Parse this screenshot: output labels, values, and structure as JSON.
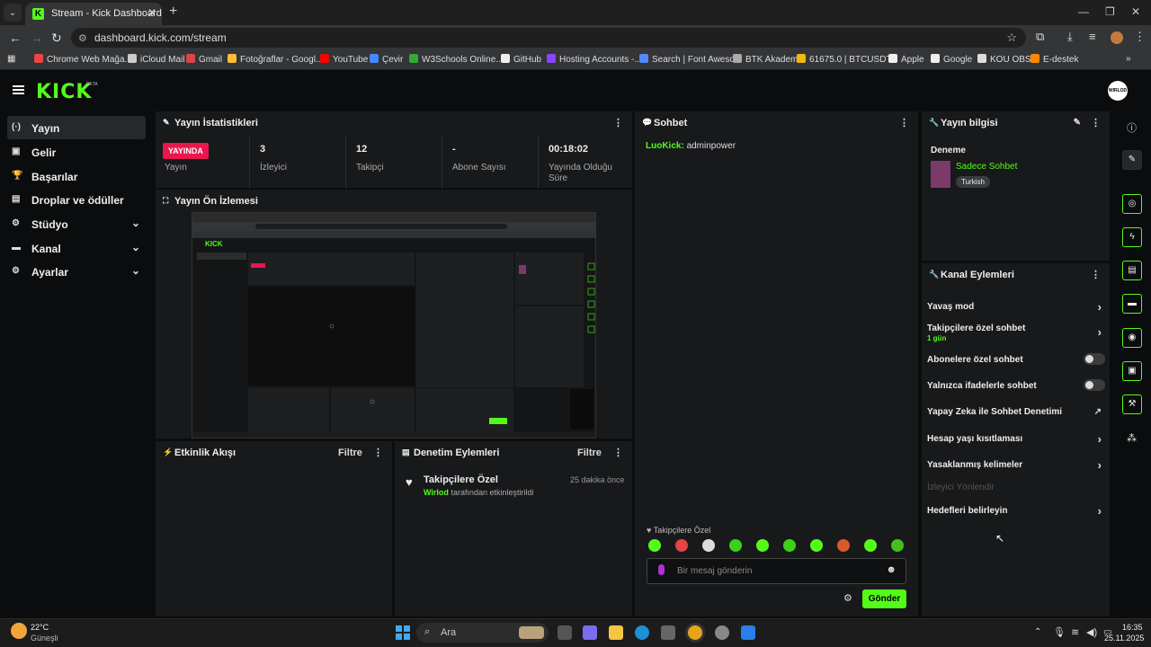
{
  "browser": {
    "tab_title": "Stream - Kick Dashboard",
    "url": "dashboard.kick.com/stream",
    "bookmarks": [
      "Chrome Web Mağa...",
      "iCloud Mail",
      "Gmail",
      "Fotoğraflar - Googl...",
      "YouTube",
      "Çevir",
      "W3Schools Online...",
      "GitHub",
      "Hosting Accounts -...",
      "Search | Font Aweso...",
      "BTK Akademi",
      "61675.0 | BTCUSDT...",
      "Apple",
      "Google",
      "KOU OBS",
      "E-destek"
    ]
  },
  "header": {
    "logo": "KICK",
    "beta": "BETA",
    "avatar_text": "WIRLOD"
  },
  "sidebar": {
    "items": [
      {
        "label": "Yayın",
        "icon": "broadcast-icon"
      },
      {
        "label": "Gelir",
        "icon": "revenue-icon"
      },
      {
        "label": "Başarılar",
        "icon": "trophy-icon"
      },
      {
        "label": "Droplar ve ödüller",
        "icon": "gift-icon"
      },
      {
        "label": "Stüdyo",
        "icon": "gear-icon"
      },
      {
        "label": "Kanal",
        "icon": "channel-icon"
      },
      {
        "label": "Ayarlar",
        "icon": "settings-icon"
      }
    ]
  },
  "stats": {
    "title": "Yayın İstatistikleri",
    "live_badge": "YAYINDA",
    "items": [
      {
        "value": "",
        "label": "Yayın"
      },
      {
        "value": "3",
        "label": "İzleyici"
      },
      {
        "value": "12",
        "label": "Takipçi"
      },
      {
        "value": "-",
        "label": "Abone Sayısı"
      },
      {
        "value": "00:18:02",
        "label": "Yayında Olduğu Süre"
      }
    ]
  },
  "preview": {
    "title": "Yayın Ön İzlemesi"
  },
  "activity": {
    "title": "Etkinlik Akışı",
    "filter": "Filtre"
  },
  "moderation": {
    "title": "Denetim Eylemleri",
    "filter": "Filtre",
    "event_title": "Takipçilere Özel",
    "event_time": "25 dakika önce",
    "event_user": "Wirlod",
    "event_desc": "tarafından etkinleştirildi"
  },
  "chat": {
    "title": "Sohbet",
    "message_user": "LuoKick:",
    "message_text": "adminpower",
    "mode_label": "Takipçilere Özel",
    "placeholder": "Bir mesaj gönderin",
    "send": "Gönder"
  },
  "stream_info": {
    "title": "Yayın bilgisi",
    "stream_title": "Deneme",
    "category": "Sadece Sohbet",
    "language": "Turkish"
  },
  "channel_actions": {
    "title": "Kanal Eylemleri",
    "slow_mode": "Yavaş mod",
    "followers_only": "Takipçilere özel sohbet",
    "followers_only_sub": "1 gün",
    "subs_only": "Abonelere özel sohbet",
    "emotes_only": "Yalnızca ifadelerle sohbet",
    "ai_moderation": "Yapay Zeka ile Sohbet Denetimi",
    "account_age": "Hesap yaşı kısıtlaması",
    "banned_words": "Yasaklanmış kelimeler",
    "redirect": "İzleyici Yönlendir",
    "goals": "Hedefleri belirleyin"
  },
  "taskbar": {
    "weather_temp": "22°C",
    "weather_desc": "Güneşli",
    "search": "Ara",
    "time": "16:35",
    "date": "25.11.2025"
  },
  "colors": {
    "accent": "#53fc18",
    "live": "#e8174c",
    "panel": "#18191b",
    "background": "#0b0c0d"
  }
}
